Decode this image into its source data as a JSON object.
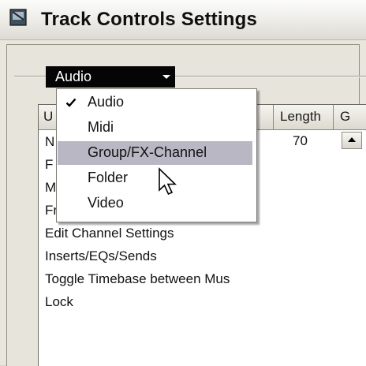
{
  "window": {
    "title": "Track Controls Settings"
  },
  "combo": {
    "value": "Audio"
  },
  "dropdown_menu": {
    "items": [
      {
        "label": "Audio",
        "checked": true
      },
      {
        "label": "Midi",
        "checked": false
      },
      {
        "label": "Group/FX-Channel",
        "highlighted": true
      },
      {
        "label": "Folder",
        "checked": false
      },
      {
        "label": "Video",
        "checked": false
      }
    ]
  },
  "list": {
    "columns": [
      "U",
      "Length",
      "G"
    ],
    "first_row_length": "70",
    "partial_rows": [
      "N",
      "F",
      "M",
      "Fr"
    ],
    "rows": [
      "Edit Channel Settings",
      "Inserts/EQs/Sends",
      "Toggle Timebase between Mus",
      "Lock"
    ]
  },
  "colors": {
    "combo_background": "#050505",
    "menu_highlight": "#b9b7c4",
    "window_background": "#e7e4dc"
  }
}
